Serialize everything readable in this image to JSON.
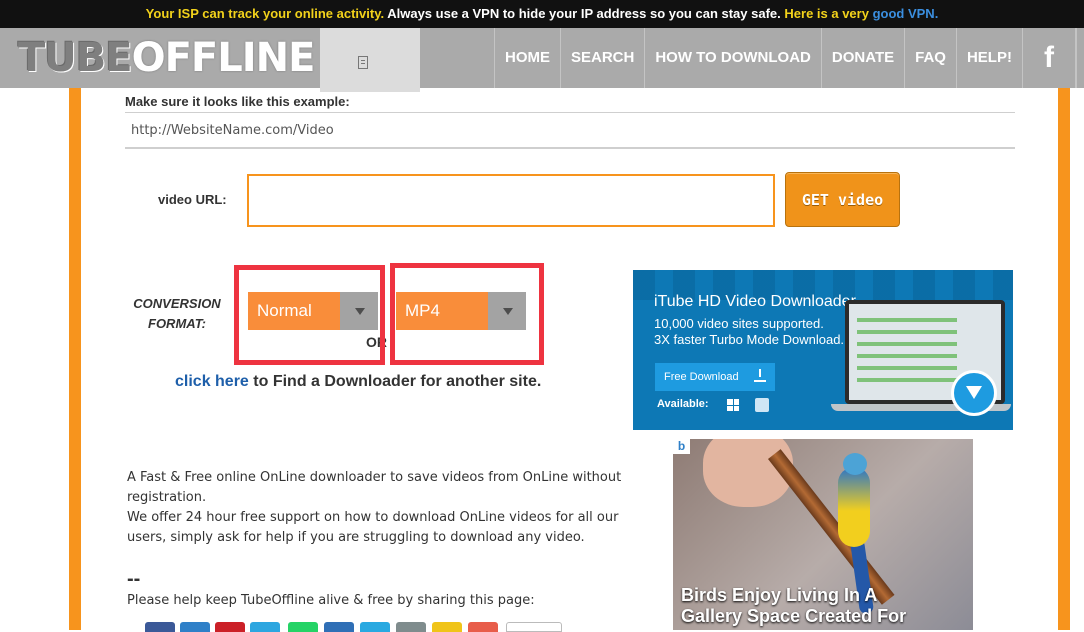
{
  "banner": {
    "part1": "Your ISP can track your online activity.",
    "part2": "Always use a VPN to hide your IP address so you can stay safe.",
    "part3": "Here is a very",
    "part4": "good VPN."
  },
  "logo": {
    "part1": "TUBE",
    "part2": "OFFLINE"
  },
  "nav": {
    "home": "HOME",
    "search": "SEARCH",
    "how_to": "HOW TO DOWNLOAD",
    "donate": "DONATE",
    "faq": "FAQ",
    "help": "HELP!",
    "facebook": "f"
  },
  "form": {
    "example_label": "Make sure it looks like this example:",
    "example_url": "http://WebsiteName.com/Video",
    "url_label": "video URL:",
    "url_value": "",
    "get_label": "GET video",
    "conversion_label": "CONVERSION FORMAT:",
    "quality": "Normal",
    "format": "MP4",
    "or": "OR",
    "click_here": "click here",
    "find_text": " to Find a Downloader for another site."
  },
  "ad1": {
    "title": "iTube HD Video Downloader",
    "line1": "10,000 video sites supported.",
    "line2": "3X faster Turbo Mode Download.",
    "button": "Free Download",
    "available": "Available:"
  },
  "ad2": {
    "badge": "b",
    "caption": "Birds Enjoy Living In A\nGallery Space Created For"
  },
  "desc": {
    "p1": "A Fast & Free online OnLine downloader to save videos from OnLine without registration.",
    "p2": "We offer 24 hour free support on how to download OnLine videos for all our users, simply ask for help if you are struggling to download any video.",
    "dashes": "--",
    "share": "Please help keep TubeOffline alive & free by sharing this page:"
  },
  "colors": {
    "accent_orange": "#f7941d",
    "header_gray": "#aaaaaa",
    "highlight_red": "#ee3340",
    "link_blue": "#1e5faa",
    "ad_blue": "#0d78b5"
  },
  "icons": {
    "tab": "page-icon",
    "facebook": "facebook-icon",
    "download": "download-arrow-icon",
    "windows": "windows-icon",
    "mac": "mac-icon"
  }
}
